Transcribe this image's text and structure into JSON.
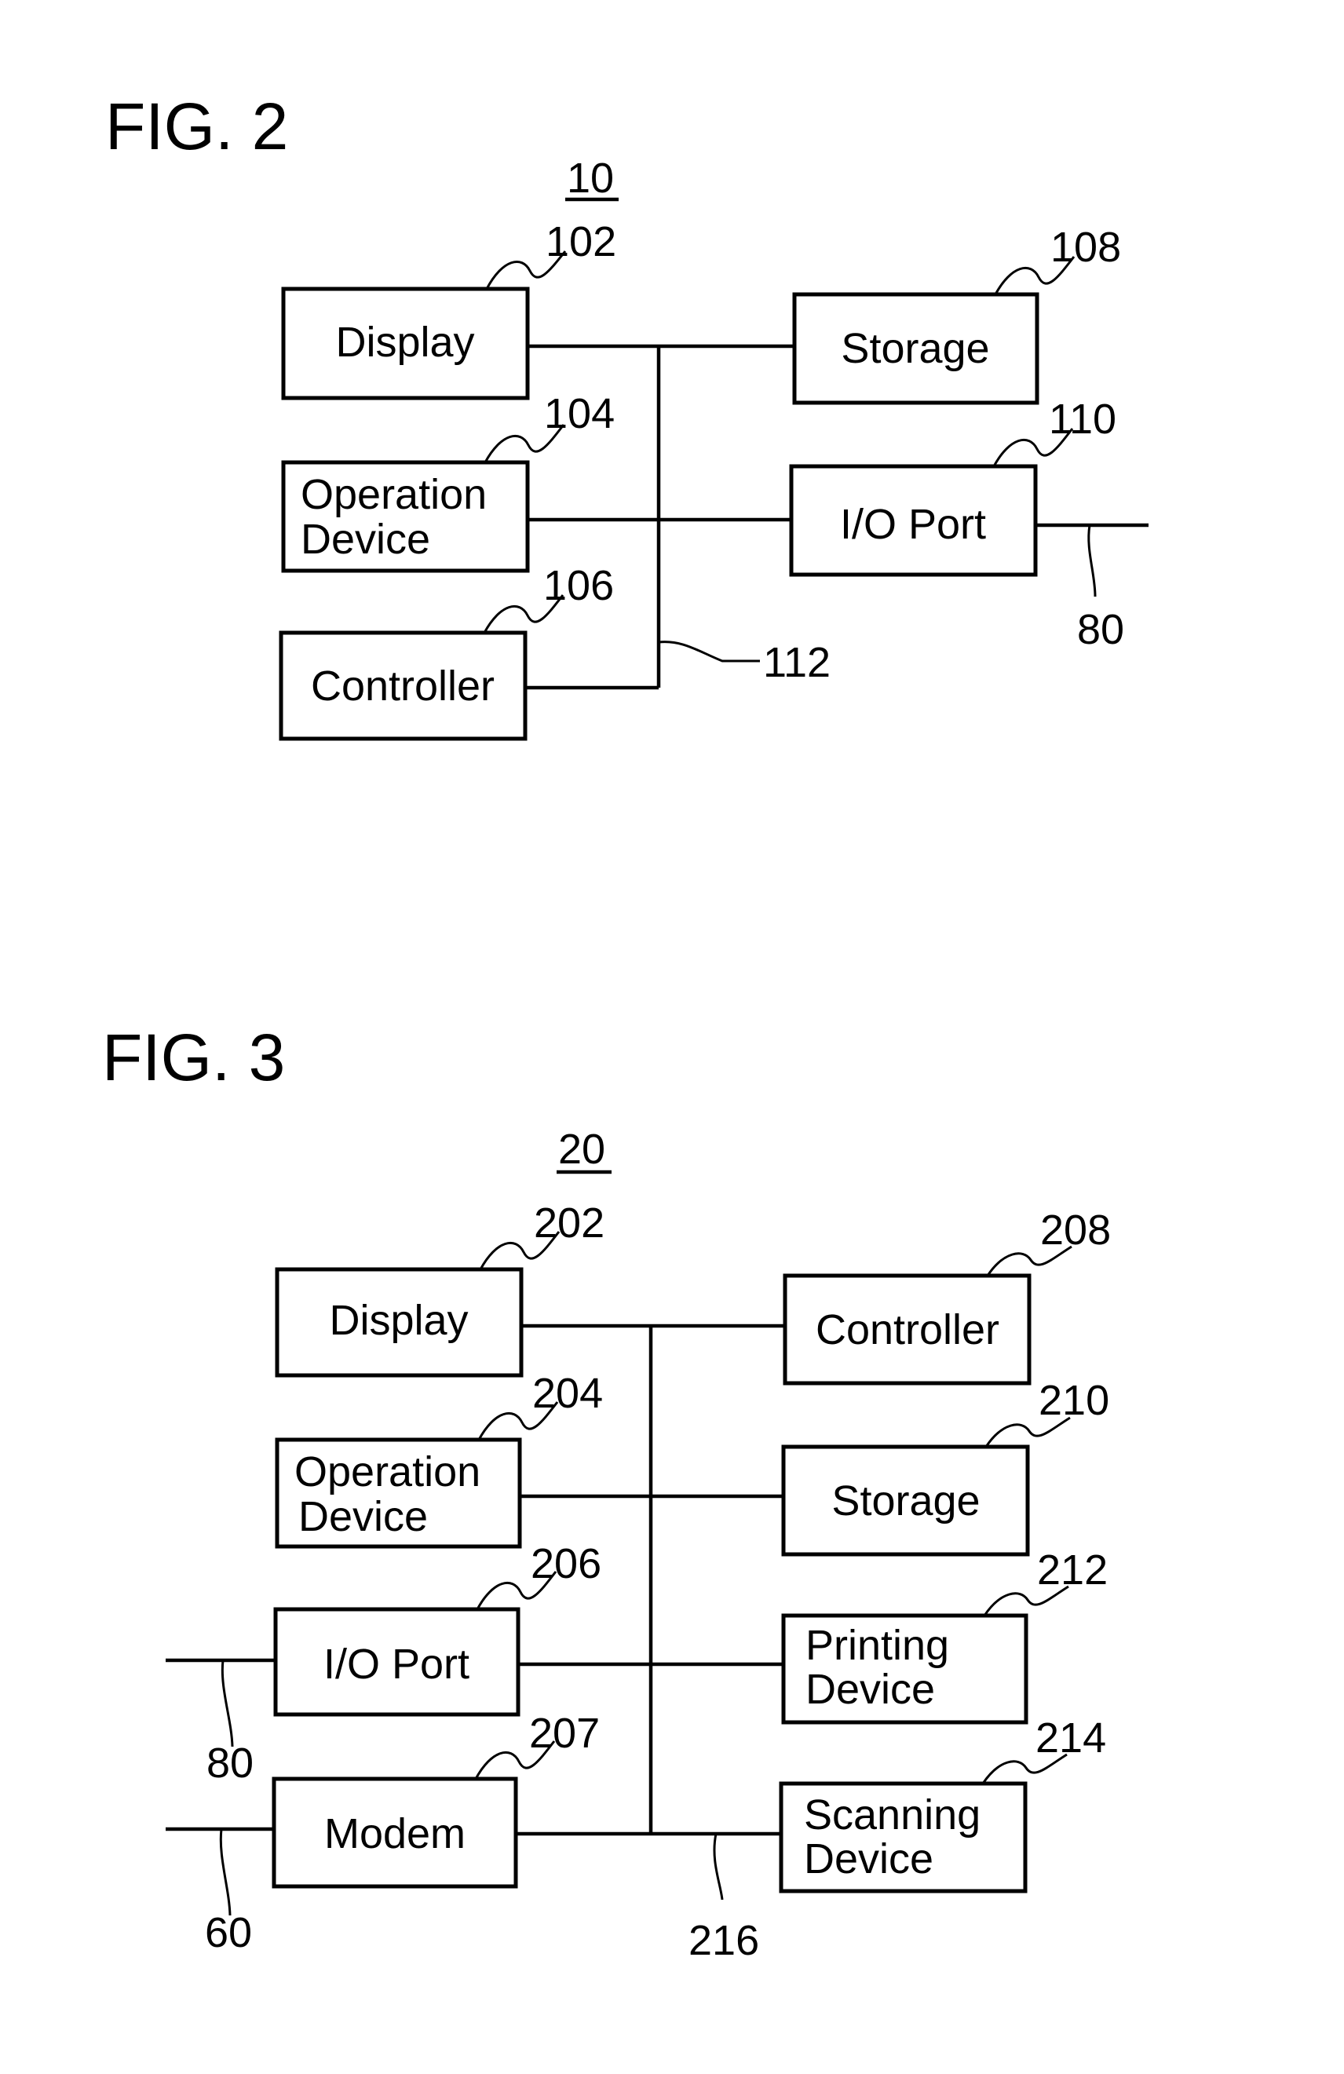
{
  "figures": [
    {
      "title": "FIG. 2",
      "device_ref": "10",
      "blocks": [
        {
          "ref": "102",
          "lines": [
            "Display"
          ]
        },
        {
          "ref": "104",
          "lines": [
            "Operation",
            "Device"
          ]
        },
        {
          "ref": "106",
          "lines": [
            "Controller"
          ]
        },
        {
          "ref": "108",
          "lines": [
            "Storage"
          ]
        },
        {
          "ref": "110",
          "lines": [
            "I/O Port"
          ]
        }
      ],
      "bus_ref": "112",
      "external_refs": [
        "80"
      ]
    },
    {
      "title": "FIG. 3",
      "device_ref": "20",
      "blocks": [
        {
          "ref": "202",
          "lines": [
            "Display"
          ]
        },
        {
          "ref": "204",
          "lines": [
            "Operation",
            "Device"
          ]
        },
        {
          "ref": "206",
          "lines": [
            "I/O Port"
          ]
        },
        {
          "ref": "207",
          "lines": [
            "Modem"
          ]
        },
        {
          "ref": "208",
          "lines": [
            "Controller"
          ]
        },
        {
          "ref": "210",
          "lines": [
            "Storage"
          ]
        },
        {
          "ref": "212",
          "lines": [
            "Printing",
            "Device"
          ]
        },
        {
          "ref": "214",
          "lines": [
            "Scanning",
            "Device"
          ]
        }
      ],
      "bus_ref": "216",
      "external_refs": [
        "80",
        "60"
      ]
    }
  ]
}
